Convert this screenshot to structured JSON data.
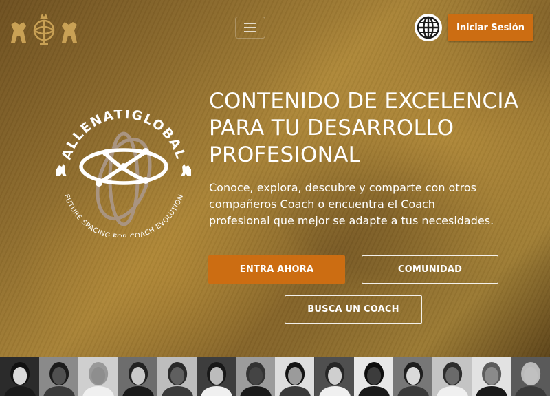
{
  "header": {
    "logo_icon": "lions-globe-crest-icon",
    "menu_icon": "hamburger-icon",
    "language_icon": "globe-icon",
    "login_label": "Iniciar Sesión"
  },
  "emblem": {
    "icon": "allenatiglobal-emblem",
    "top_text": "ALLENATIGLOBAL",
    "bottom_text": "FUTURE SPACING FOR COACH EVOLUTION"
  },
  "hero": {
    "headline": "CONTENIDO DE EXCELENCIA PARA TU DESARROLLO PROFESIONAL",
    "subtext": "Conoce, explora, descubre y comparte con otros compañeros Coach o encuentra el Coach profesional que mejor se adapte a tus necesidades.",
    "primary_cta": "ENTRA AHORA",
    "community_cta": "COMUNIDAD",
    "find_coach_cta": "BUSCA UN COACH"
  },
  "coach_strip": {
    "photo_icon": "coach-portrait",
    "count": 14
  },
  "colors": {
    "accent": "#cc6d12",
    "gold": "#a78236",
    "text": "#ffffff"
  }
}
